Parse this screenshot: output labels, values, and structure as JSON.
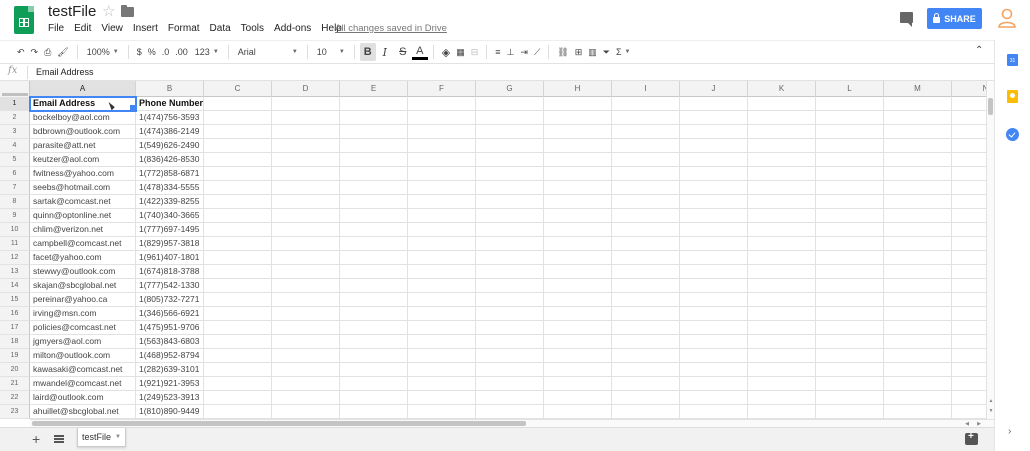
{
  "app": {
    "title": "testFile",
    "save_status": "All changes saved in Drive",
    "share_label": "SHARE",
    "menu": [
      "File",
      "Edit",
      "View",
      "Insert",
      "Format",
      "Data",
      "Tools",
      "Add-ons",
      "Help"
    ]
  },
  "toolbar": {
    "zoom": "100%",
    "currency": "$",
    "percent": "%",
    "decrease_decimal": ".0",
    "increase_decimal": ".00",
    "more_formats": "123",
    "font": "Arial",
    "font_size": "10",
    "bold": "B",
    "italic": "I",
    "strikethrough": "S",
    "text_color": "A",
    "function": "Σ"
  },
  "formula_bar": {
    "fx_label": "fx",
    "value": "Email Address"
  },
  "grid": {
    "columns": [
      "A",
      "B",
      "C",
      "D",
      "E",
      "F",
      "G",
      "H",
      "I",
      "J",
      "K",
      "L",
      "M",
      "N"
    ],
    "row_numbers": [
      "1",
      "2",
      "3",
      "4",
      "5",
      "6",
      "7",
      "8",
      "9",
      "10",
      "11",
      "12",
      "13",
      "14",
      "15",
      "16",
      "17",
      "18",
      "19",
      "20",
      "21",
      "22",
      "23"
    ],
    "selected_column": "A",
    "selected_row": "1",
    "rows": [
      [
        "Email Address",
        "Phone Number"
      ],
      [
        "bockelboy@aol.com",
        "1(474)756-3593"
      ],
      [
        "bdbrown@outlook.com",
        "1(474)386-2149"
      ],
      [
        "parasite@att.net",
        "1(549)626-2490"
      ],
      [
        "keutzer@aol.com",
        "1(836)426-8530"
      ],
      [
        "fwitness@yahoo.com",
        "1(772)858-6871"
      ],
      [
        "seebs@hotmail.com",
        "1(478)334-5555"
      ],
      [
        "sartak@comcast.net",
        "1(422)339-8255"
      ],
      [
        "quinn@optonline.net",
        "1(740)340-3665"
      ],
      [
        "chlim@verizon.net",
        "1(777)697-1495"
      ],
      [
        "campbell@comcast.net",
        "1(829)957-3818"
      ],
      [
        "facet@yahoo.com",
        "1(961)407-1801"
      ],
      [
        "stewwy@outlook.com",
        "1(674)818-3788"
      ],
      [
        "skajan@sbcglobal.net",
        "1(777)542-1330"
      ],
      [
        "pereinar@yahoo.ca",
        "1(805)732-7271"
      ],
      [
        "irving@msn.com",
        "1(346)566-6921"
      ],
      [
        "policies@comcast.net",
        "1(475)951-9706"
      ],
      [
        "jgmyers@aol.com",
        "1(563)843-6803"
      ],
      [
        "milton@outlook.com",
        "1(468)952-8794"
      ],
      [
        "kawasaki@comcast.net",
        "1(282)639-3101"
      ],
      [
        "mwandel@comcast.net",
        "1(921)921-3953"
      ],
      [
        "laird@outlook.com",
        "1(249)523-3913"
      ],
      [
        "ahuillet@sbcglobal.net",
        "1(810)890-9449"
      ]
    ]
  },
  "sheets": {
    "tabs": [
      "testFile"
    ],
    "active": "testFile"
  },
  "side_panel": {
    "calendar_label": "31"
  },
  "colors": {
    "share_blue": "#4285f4",
    "sheets_green": "#0f9d58",
    "keep_yellow": "#fbbc04",
    "column_i_header": "#d93025"
  }
}
